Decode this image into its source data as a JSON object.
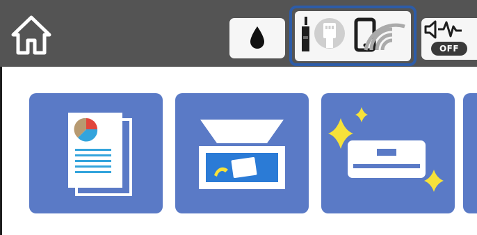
{
  "header": {
    "home_icon": "home-icon",
    "ink_icon": "ink-drop-icon",
    "network": {
      "highlighted": true,
      "wired_icon": "ethernet-icon",
      "wifi_icon": "wifi-direct-icon"
    },
    "sound": {
      "icon": "speaker-icon",
      "status_label": "OFF"
    }
  },
  "menu": {
    "tiles": [
      {
        "id": "copy",
        "icon": "copy-icon"
      },
      {
        "id": "scan",
        "icon": "scan-icon"
      },
      {
        "id": "maintenance",
        "icon": "maintenance-icon"
      },
      {
        "id": "more",
        "icon": "partial-tile"
      }
    ]
  },
  "colors": {
    "top_bar": "#545454",
    "tile": "#5a7ac6",
    "highlight_border": "#2d5ca8",
    "sparkle": "#f6e23a",
    "pie_red": "#e1463c",
    "pie_blue": "#33a4dc",
    "pie_tan": "#b79a71"
  }
}
